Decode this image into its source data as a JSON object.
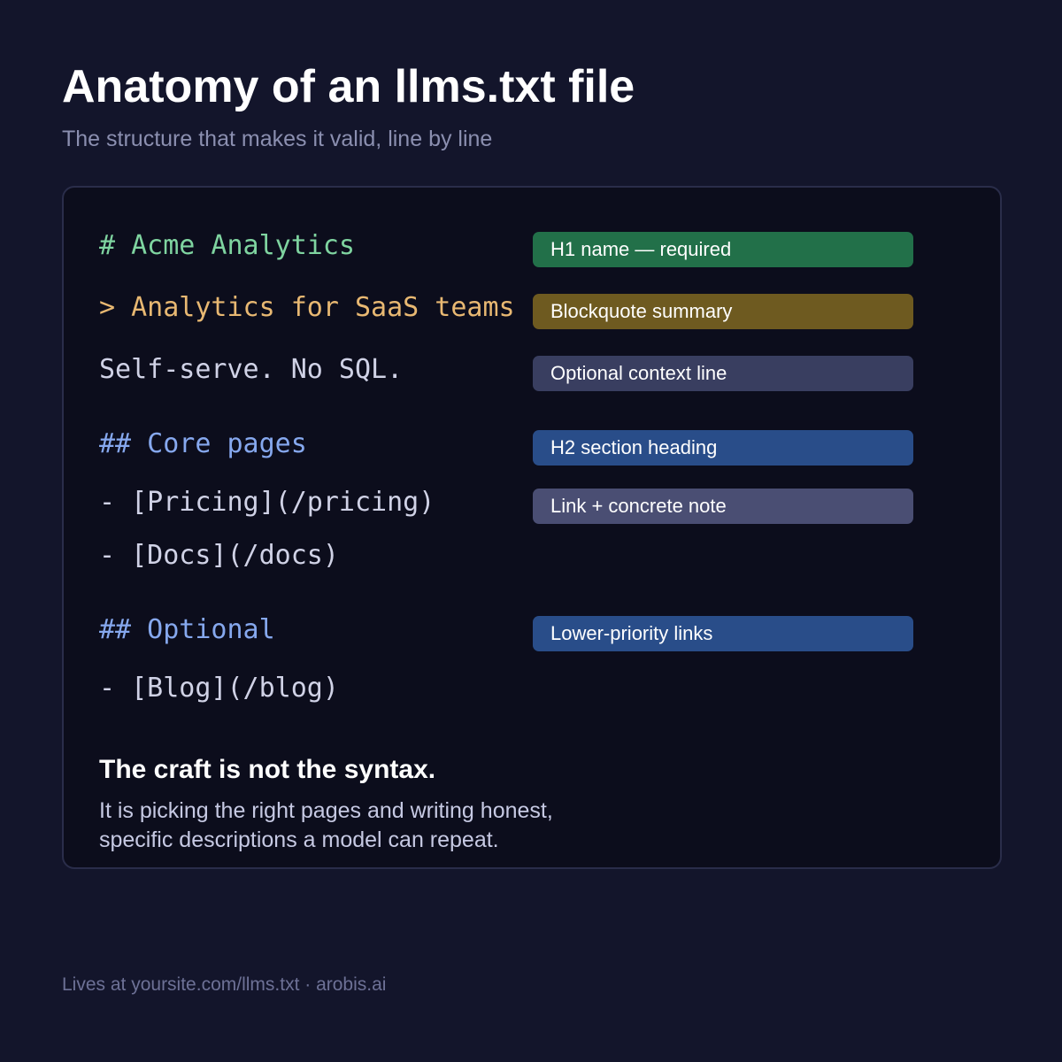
{
  "header": {
    "title": "Anatomy of an llms.txt file",
    "subtitle": "The structure that makes it valid, line by line"
  },
  "rows": [
    {
      "code": "# Acme Analytics",
      "label": "H1 name — required",
      "color": "#227049"
    },
    {
      "code": "> Analytics for SaaS teams",
      "label": "Blockquote summary",
      "color": "#6e5a20"
    },
    {
      "code": "Self-serve. No SQL.",
      "label": "Optional context line",
      "color": "#393e60"
    },
    {
      "code": "## Core pages",
      "label": "H2 section heading",
      "color": "#294d89"
    },
    {
      "code": "- [Pricing](/pricing)",
      "label": "Link + concrete note",
      "color": "#4a4e73"
    },
    {
      "code": "- [Docs](/docs)"
    },
    {
      "code": "## Optional",
      "label": "Lower-priority links",
      "color": "#294d89"
    },
    {
      "code": "- [Blog](/blog)"
    }
  ],
  "callout": {
    "title": "The craft is not the syntax.",
    "body": "It is picking the right pages and writing honest, specific descriptions a model can repeat."
  },
  "footer": {
    "text": "Lives at yoursite.com/llms.txt · arobis.ai"
  }
}
